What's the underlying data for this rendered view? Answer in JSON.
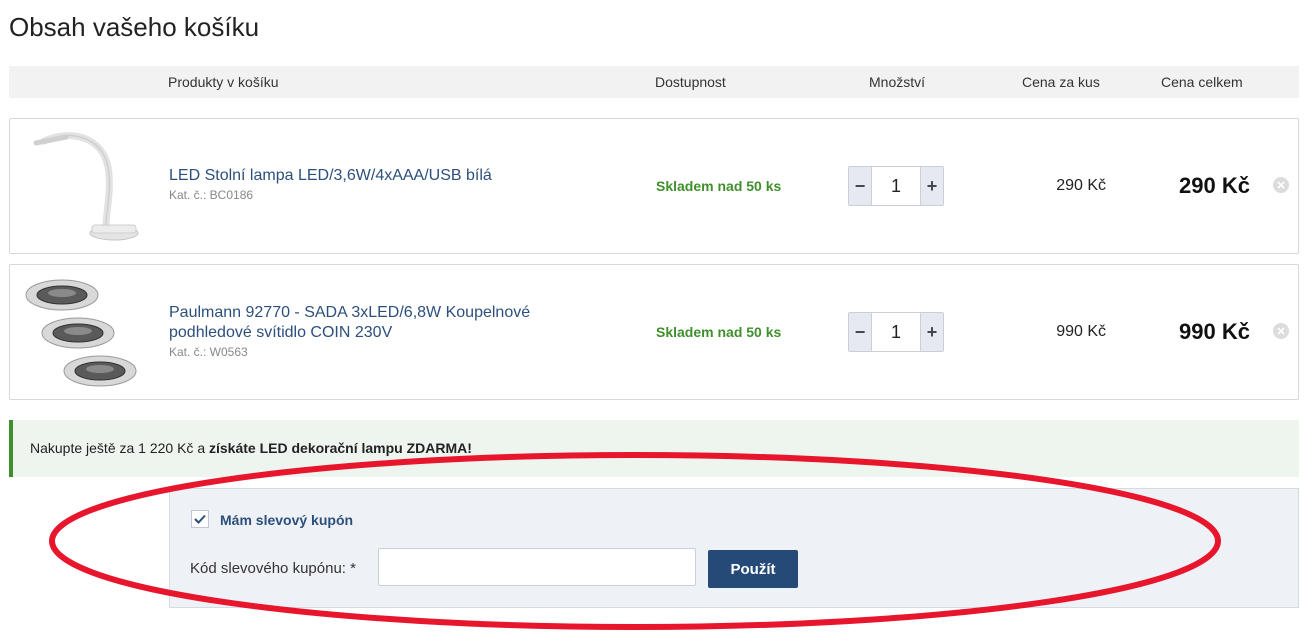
{
  "page": {
    "title": "Obsah vašeho košíku"
  },
  "header": {
    "products": "Produkty v košíku",
    "availability": "Dostupnost",
    "quantity": "Množství",
    "unit_price": "Cena za kus",
    "total_price": "Cena celkem"
  },
  "items": [
    {
      "name": "LED Stolní lampa LED/3,6W/4xAAA/USB bílá",
      "sku": "Kat. č.: BC0186",
      "availability": "Skladem nad 50 ks",
      "quantity": "1",
      "unit_price": "290 Kč",
      "total_price": "290 Kč",
      "thumbnail_icon": "desk-lamp-icon"
    },
    {
      "name": "Paulmann 92770 - SADA 3xLED/6,8W Koupelnové podhledové svítidlo COIN 230V",
      "sku": "Kat. č.: W0563",
      "availability": "Skladem nad 50 ks",
      "quantity": "1",
      "unit_price": "990 Kč",
      "total_price": "990 Kč",
      "thumbnail_icon": "recessed-lights-icon"
    }
  ],
  "qty_controls": {
    "minus": "−",
    "plus": "+"
  },
  "promo": {
    "text_prefix": "Nakupte ještě za 1 220 Kč a ",
    "text_strong": "získáte LED dekorační lampu ZDARMA!"
  },
  "coupon": {
    "checkbox_label": "Mám slevový kupón",
    "checked": true,
    "field_label": "Kód slevového kupónu: *",
    "input_value": "",
    "apply_label": "Použít"
  },
  "colors": {
    "link": "#2c4f7c",
    "stock_green": "#3f8f2c",
    "button": "#264a78",
    "annotation_red": "#e8162c"
  }
}
